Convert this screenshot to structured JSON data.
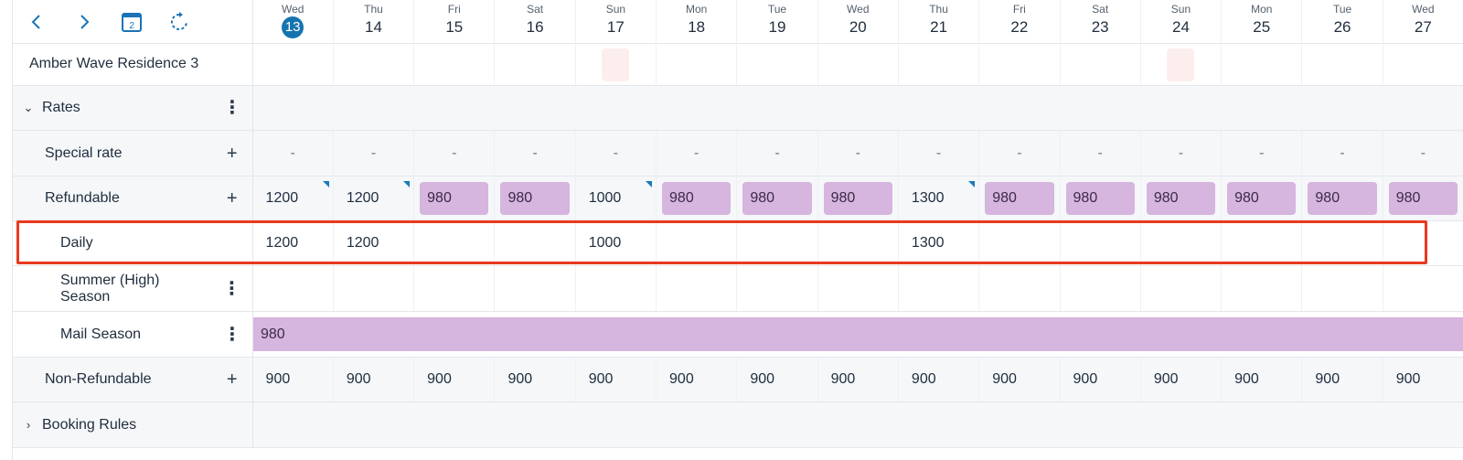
{
  "toolbar": {
    "prev_icon": "chevron-left-icon",
    "next_icon": "chevron-right-icon",
    "calendar_icon": "calendar-icon",
    "calendar_badge": "2",
    "refresh_icon": "refresh-icon"
  },
  "days": [
    {
      "dow": "Wed",
      "num": "13",
      "today": true
    },
    {
      "dow": "Thu",
      "num": "14"
    },
    {
      "dow": "Fri",
      "num": "15"
    },
    {
      "dow": "Sat",
      "num": "16"
    },
    {
      "dow": "Sun",
      "num": "17"
    },
    {
      "dow": "Mon",
      "num": "18"
    },
    {
      "dow": "Tue",
      "num": "19"
    },
    {
      "dow": "Wed",
      "num": "20"
    },
    {
      "dow": "Thu",
      "num": "21"
    },
    {
      "dow": "Fri",
      "num": "22"
    },
    {
      "dow": "Sat",
      "num": "23"
    },
    {
      "dow": "Sun",
      "num": "24"
    },
    {
      "dow": "Mon",
      "num": "25"
    },
    {
      "dow": "Tue",
      "num": "26"
    },
    {
      "dow": "Wed",
      "num": "27"
    }
  ],
  "property": {
    "name": "Amber Wave Residence 3"
  },
  "sections": {
    "rates": {
      "label": "Rates",
      "expanded": true
    },
    "booking_rules": {
      "label": "Booking Rules",
      "expanded": false
    }
  },
  "rows": {
    "special_rate": {
      "label": "Special rate",
      "values": [
        "-",
        "-",
        "-",
        "-",
        "-",
        "-",
        "-",
        "-",
        "-",
        "-",
        "-",
        "-",
        "-",
        "-",
        "-"
      ]
    },
    "refundable": {
      "label": "Refundable",
      "values": [
        "1200",
        "1200",
        "980",
        "980",
        "1000",
        "980",
        "980",
        "980",
        "1300",
        "980",
        "980",
        "980",
        "980",
        "980",
        "980"
      ]
    },
    "daily": {
      "label": "Daily",
      "values": [
        "1200",
        "1200",
        "",
        "",
        "1000",
        "",
        "",
        "",
        "1300",
        "",
        "",
        "",
        "",
        "",
        ""
      ]
    },
    "summer": {
      "label_line1": "Summer (High)",
      "label_line2": "Season"
    },
    "mail_season": {
      "label": "Mail Season",
      "value": "980"
    },
    "non_refundable": {
      "label": "Non-Refundable",
      "values": [
        "900",
        "900",
        "900",
        "900",
        "900",
        "900",
        "900",
        "900",
        "900",
        "900",
        "900",
        "900",
        "900",
        "900",
        "900"
      ]
    }
  },
  "colors": {
    "accent": "#1773b0",
    "chip": "#d6b5de",
    "highlight": "#e8391e",
    "blocked": "#fdeeee"
  }
}
